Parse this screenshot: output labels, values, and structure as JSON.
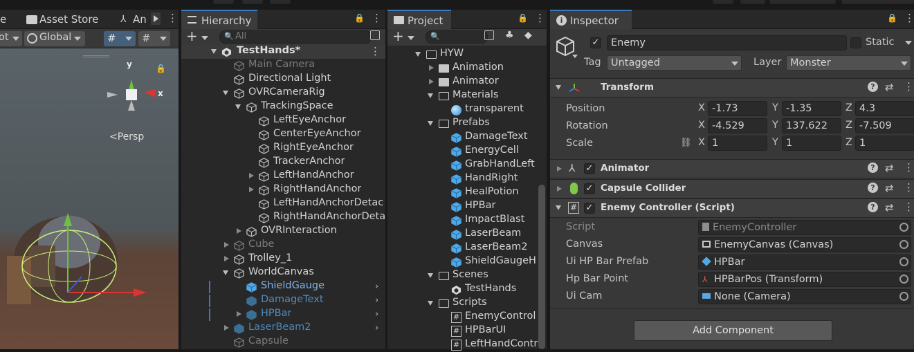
{
  "scene_panel": {
    "tabs": [
      {
        "label": "e"
      },
      {
        "label": "Asset Store"
      },
      {
        "label": "An"
      }
    ],
    "toolbar": {
      "pivot": "ot",
      "global": "Global"
    },
    "gizmo": {
      "y": "y",
      "x": "x",
      "persp": "Persp"
    }
  },
  "hierarchy": {
    "title": "Hierarchy",
    "search_placeholder": "All",
    "scene_name": "TestHands*",
    "items": [
      {
        "label": "Main Camera",
        "depth": 1,
        "fold": "none",
        "dim": true,
        "selected": false
      },
      {
        "label": "Directional Light",
        "depth": 1,
        "fold": "none",
        "dim": false,
        "selected": false
      },
      {
        "label": "OVRCameraRig",
        "depth": 1,
        "fold": "open",
        "dim": false,
        "selected": false
      },
      {
        "label": "TrackingSpace",
        "depth": 2,
        "fold": "open",
        "dim": false,
        "selected": false
      },
      {
        "label": "LeftEyeAnchor",
        "depth": 3,
        "fold": "none",
        "dim": false,
        "selected": false
      },
      {
        "label": "CenterEyeAnchor",
        "depth": 3,
        "fold": "none",
        "dim": false,
        "selected": false
      },
      {
        "label": "RightEyeAnchor",
        "depth": 3,
        "fold": "none",
        "dim": false,
        "selected": false
      },
      {
        "label": "TrackerAnchor",
        "depth": 3,
        "fold": "none",
        "dim": false,
        "selected": false
      },
      {
        "label": "LeftHandAnchor",
        "depth": 3,
        "fold": "closed",
        "dim": false,
        "selected": false
      },
      {
        "label": "RightHandAnchor",
        "depth": 3,
        "fold": "closed",
        "dim": false,
        "selected": false
      },
      {
        "label": "LeftHandAnchorDetac",
        "depth": 3,
        "fold": "none",
        "dim": false,
        "selected": false
      },
      {
        "label": "RightHandAnchorDeta",
        "depth": 3,
        "fold": "none",
        "dim": false,
        "selected": false
      },
      {
        "label": "OVRInteraction",
        "depth": 2,
        "fold": "closed",
        "dim": false,
        "selected": false
      },
      {
        "label": "Cube",
        "depth": 1,
        "fold": "closed",
        "dim": true,
        "selected": false
      },
      {
        "label": "Trolley_1",
        "depth": 1,
        "fold": "closed",
        "dim": false,
        "selected": false
      },
      {
        "label": "WorldCanvas",
        "depth": 1,
        "fold": "open",
        "dim": false,
        "selected": false
      },
      {
        "label": "ShieldGauge",
        "depth": 2,
        "fold": "none",
        "dim": false,
        "selected": true,
        "prefab": true
      },
      {
        "label": "DamageText",
        "depth": 2,
        "fold": "none",
        "dim": true,
        "selected": true,
        "prefab": true
      },
      {
        "label": "HPBar",
        "depth": 2,
        "fold": "closed",
        "dim": true,
        "selected": true,
        "prefab": true
      },
      {
        "label": "LaserBeam2",
        "depth": 1,
        "fold": "closed",
        "dim": true,
        "selected": false,
        "prefab": true
      },
      {
        "label": "Capsule",
        "depth": 1,
        "fold": "none",
        "dim": true,
        "selected": false
      }
    ]
  },
  "project": {
    "title": "Project",
    "items": [
      {
        "label": "HYW",
        "depth": 0,
        "kind": "folder-open"
      },
      {
        "label": "Animation",
        "depth": 1,
        "kind": "folder"
      },
      {
        "label": "Animator",
        "depth": 1,
        "kind": "folder"
      },
      {
        "label": "Materials",
        "depth": 1,
        "kind": "folder-open"
      },
      {
        "label": "transparent",
        "depth": 2,
        "kind": "material"
      },
      {
        "label": "Prefabs",
        "depth": 1,
        "kind": "folder-open"
      },
      {
        "label": "DamageText",
        "depth": 2,
        "kind": "prefab"
      },
      {
        "label": "EnergyCell",
        "depth": 2,
        "kind": "prefab"
      },
      {
        "label": "GrabHandLeft",
        "depth": 2,
        "kind": "prefab"
      },
      {
        "label": "HandRight",
        "depth": 2,
        "kind": "prefab"
      },
      {
        "label": "HealPotion",
        "depth": 2,
        "kind": "prefab"
      },
      {
        "label": "HPBar",
        "depth": 2,
        "kind": "prefab"
      },
      {
        "label": "ImpactBlast",
        "depth": 2,
        "kind": "prefab"
      },
      {
        "label": "LaserBeam",
        "depth": 2,
        "kind": "prefab"
      },
      {
        "label": "LaserBeam2",
        "depth": 2,
        "kind": "prefab"
      },
      {
        "label": "ShieldGaugeH",
        "depth": 2,
        "kind": "prefab"
      },
      {
        "label": "Scenes",
        "depth": 1,
        "kind": "folder-open"
      },
      {
        "label": "TestHands",
        "depth": 2,
        "kind": "scene"
      },
      {
        "label": "Scripts",
        "depth": 1,
        "kind": "folder-open"
      },
      {
        "label": "EnemyControl",
        "depth": 2,
        "kind": "script"
      },
      {
        "label": "HPBarUI",
        "depth": 2,
        "kind": "script"
      },
      {
        "label": "LeftHandContr",
        "depth": 2,
        "kind": "script"
      }
    ]
  },
  "inspector": {
    "title": "Inspector",
    "object_name": "Enemy",
    "static_label": "Static",
    "tag_label": "Tag",
    "tag_value": "Untagged",
    "layer_label": "Layer",
    "layer_value": "Monster",
    "transform": {
      "title": "Transform",
      "position_label": "Position",
      "rotation_label": "Rotation",
      "scale_label": "Scale",
      "position": {
        "x": "-1.73",
        "y": "-1.35",
        "z": "4.3"
      },
      "rotation": {
        "x": "-4.529",
        "y": "137.622",
        "z": "-7.509"
      },
      "scale": {
        "x": "1",
        "y": "1",
        "z": "1"
      },
      "axis_x": "X",
      "axis_y": "Y",
      "axis_z": "Z"
    },
    "animator": {
      "title": "Animator"
    },
    "collider": {
      "title": "Capsule Collider"
    },
    "script_component": {
      "title": "Enemy Controller (Script)",
      "fields": [
        {
          "label": "Script",
          "value": "EnemyController",
          "icon": "script-file-icon",
          "dim": true
        },
        {
          "label": "Canvas",
          "value": "EnemyCanvas (Canvas)",
          "icon": "canvas-icon",
          "dim": false
        },
        {
          "label": "Ui HP Bar Prefab",
          "value": "HPBar",
          "icon": "prefab-icon",
          "dim": false
        },
        {
          "label": "Hp Bar Point",
          "value": "HPBarPos (Transform)",
          "icon": "transform-icon",
          "dim": false
        },
        {
          "label": "Ui Cam",
          "value": "None (Camera)",
          "icon": "camera-icon",
          "dim": false
        }
      ]
    },
    "add_component": "Add Component"
  },
  "colors": {
    "accent": "#3a79bb",
    "selected_text": "#7fb2ea",
    "prefab_blue": "#4fa9e8",
    "panel": "#282828",
    "inspector": "#383838"
  }
}
